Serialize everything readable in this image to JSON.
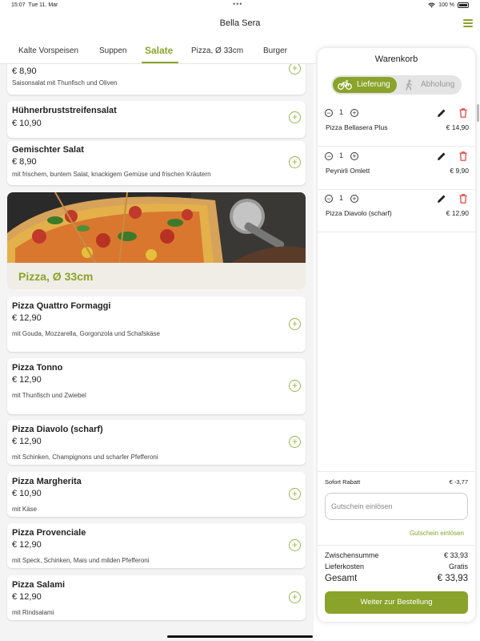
{
  "status_bar": {
    "time": "15:07",
    "date": "Tue 11. Mar",
    "battery": "100 %",
    "icons": [
      "wifi-icon",
      "battery-icon"
    ]
  },
  "header": {
    "title": "Bella Sera",
    "menu_icon": "hamburger-menu-icon"
  },
  "tabs": [
    {
      "label": "Kalte Vorspeisen",
      "active": false
    },
    {
      "label": "Suppen",
      "active": false
    },
    {
      "label": "Salate",
      "active": true
    },
    {
      "label": "Pizza, Ø 33cm",
      "active": false
    },
    {
      "label": "Burger",
      "active": false
    }
  ],
  "menu": {
    "salads": [
      {
        "name": "",
        "price": "€ 8,90",
        "desc": "Saisonsalat mit Thunfisch und Oliven"
      },
      {
        "name": "Hühnerbruststreifensalat",
        "price": "€ 10,90",
        "desc": ""
      },
      {
        "name": "Gemischter Salat",
        "price": "€ 8,90",
        "desc": "mit frischem, buntem Salat, knackigem Gemüse und frischen Kräutern"
      }
    ],
    "section_title": "Pizza, Ø 33cm",
    "pizzas": [
      {
        "name": "Pizza Quattro Formaggi",
        "price": "€ 12,90",
        "desc": "mit Gouda, Mozzarella, Gorgonzola und Schafskäse"
      },
      {
        "name": "Pizza Tonno",
        "price": "€ 12,90",
        "desc": "mit Thunfisch und Zwiebel"
      },
      {
        "name": "Pizza Diavolo (scharf)",
        "price": "€ 12,90",
        "desc": "mit Schinken, Champignons und scharfer Pfefferoni"
      },
      {
        "name": "Pizza Margherita",
        "price": "€ 10,90",
        "desc": "mit Käse"
      },
      {
        "name": "Pizza Provenciale",
        "price": "€ 12,90",
        "desc": "mit Speck, Schinken, Mais und milden Pfefferoni"
      },
      {
        "name": "Pizza Salami",
        "price": "€ 12,90",
        "desc": "mit Rindsalami"
      }
    ],
    "add_icon": "plus-circle-icon"
  },
  "cart": {
    "title": "Warenkorb",
    "delivery_label": "Lieferung",
    "pickup_label": "Abholung",
    "items": [
      {
        "qty": "1",
        "name": "Pizza Bellasera Plus",
        "price": "€ 14,90"
      },
      {
        "qty": "1",
        "name": "Peynirli Omlett",
        "price": "€ 9,90"
      },
      {
        "qty": "1",
        "name": "Pizza Diavolo (scharf)",
        "price": "€ 12,90"
      }
    ],
    "discount_label": "Sofort Rabatt",
    "discount_value": "€ -3,77",
    "voucher_placeholder": "Gutschein einlösen",
    "voucher_link": "Gutschein einlösen",
    "subtotal_label": "Zwischensumme",
    "subtotal_value": "€ 33,93",
    "delivery_cost_label": "Lieferkosten",
    "delivery_cost_value": "Gratis",
    "total_label": "Gesamt",
    "total_value": "€ 33,93",
    "order_button": "Weiter zur Bestellung"
  },
  "colors": {
    "accent": "#8aa32a",
    "delete": "#e53935"
  }
}
